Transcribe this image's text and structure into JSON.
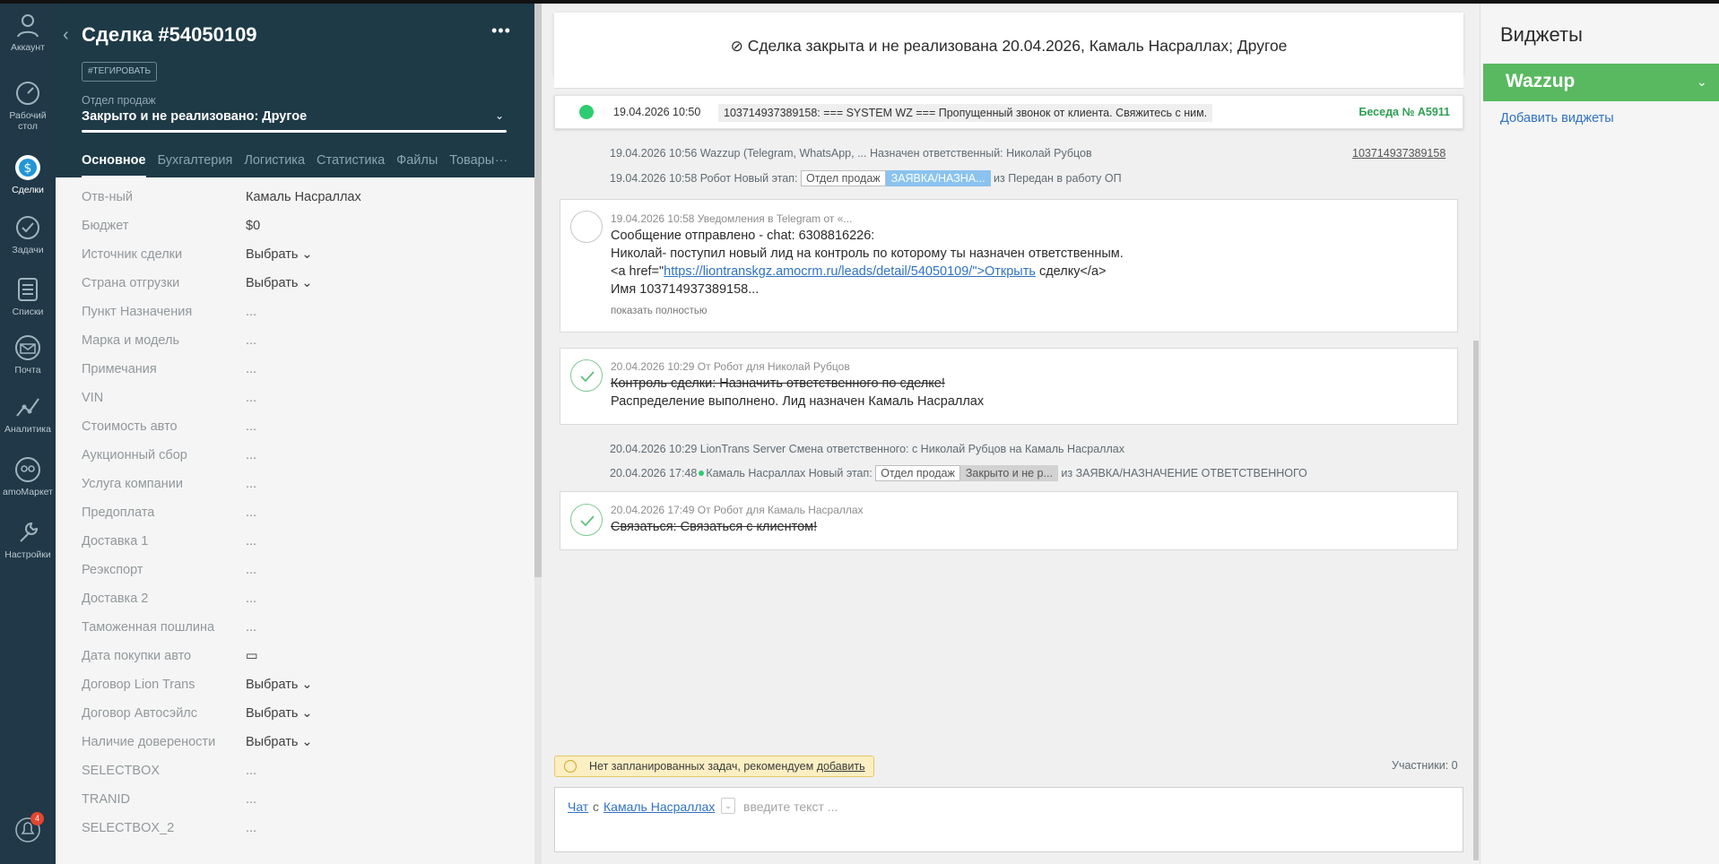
{
  "nav": {
    "items": [
      {
        "label": "Аккаунт",
        "icon": "user-icon"
      },
      {
        "label": "Рабочий стол",
        "icon": "dashboard-icon"
      },
      {
        "label": "Сделки",
        "icon": "deals-icon"
      },
      {
        "label": "Задачи",
        "icon": "tasks-icon"
      },
      {
        "label": "Списки",
        "icon": "lists-icon"
      },
      {
        "label": "Почта",
        "icon": "mail-icon"
      },
      {
        "label": "Аналитика",
        "icon": "analytics-icon"
      },
      {
        "label": "amoМаркет",
        "icon": "market-icon"
      },
      {
        "label": "Настройки",
        "icon": "settings-icon"
      }
    ],
    "notifications_badge": "4"
  },
  "card": {
    "title": "Сделка #54050109",
    "tag_button": "#ТЕГИРОВАТЬ",
    "pipeline": "Отдел продаж",
    "status": "Закрыто и не реализовано: Другое",
    "tabs": [
      "Основное",
      "Бухгалтерия",
      "Логистика",
      "Статистика",
      "Файлы",
      "Товары"
    ],
    "tabs_more": "···",
    "fields": [
      {
        "name": "Отв-ный",
        "value": "Камаль Насраллах"
      },
      {
        "name": "Бюджет",
        "value": "$0"
      },
      {
        "name": "Источник сделки",
        "value": "Выбрать ⌄"
      },
      {
        "name": "Страна отгрузки",
        "value": "Выбрать ⌄"
      },
      {
        "name": "Пункт Назначения",
        "value": "..."
      },
      {
        "name": "Марка и модель",
        "value": "..."
      },
      {
        "name": "Примечания",
        "value": "..."
      },
      {
        "name": "VIN",
        "value": "..."
      },
      {
        "name": "Стоимость авто",
        "value": "..."
      },
      {
        "name": "Аукционный сбор",
        "value": "..."
      },
      {
        "name": "Услуга компании",
        "value": "..."
      },
      {
        "name": "Предоплата",
        "value": "..."
      },
      {
        "name": "Доставка 1",
        "value": "..."
      },
      {
        "name": "Реэкспорт",
        "value": "..."
      },
      {
        "name": "Доставка 2",
        "value": "..."
      },
      {
        "name": "Таможенная пошлина",
        "value": "..."
      },
      {
        "name": "Дата покупки авто",
        "value": "▭"
      },
      {
        "name": "Договор Lion Trans",
        "value": "Выбрать ⌄"
      },
      {
        "name": "Договор Автосэйлс",
        "value": "Выбрать ⌄"
      },
      {
        "name": "Наличие доверености",
        "value": "Выбрать ⌄"
      },
      {
        "name": "SELECTBOX",
        "value": "..."
      },
      {
        "name": "TRANID",
        "value": "..."
      },
      {
        "name": "SELECTBOX_2",
        "value": "..."
      }
    ]
  },
  "feed": {
    "closed_banner": "Сделка закрыта и не реализована 20.04.2026, Камаль Насраллах; Другое",
    "whatsapp": {
      "time": "19.04.2026 10:50",
      "message": "103714937389158: === SYSTEM WZ === Пропущенный звонок от клиента. Свяжитесь с ним.",
      "conversation": "Беседа № A5911"
    },
    "notes": [
      {
        "text": "19.04.2026 10:56 Wazzup (Telegram, WhatsApp, ... Назначен ответственный: Николай Рубцов",
        "link": "103714937389158"
      },
      {
        "prefix": "19.04.2026 10:58 Робот Новый этап:",
        "pill1": "Отдел продаж",
        "pill2": "ЗАЯВКА/НАЗНА...",
        "suffix": "из Передан в работу ОП"
      },
      {
        "text": "20.04.2026 10:29 LionTrans Server Смена ответственного: с Николай Рубцов на Камаль Насраллах"
      },
      {
        "prefix": "20.04.2026 17:48",
        "author": "Камаль Насраллах Новый этап:",
        "pill1": "Отдел продаж",
        "pill2": "Закрыто и не р...",
        "suffix": "из ЗАЯВКА/НАЗНАЧЕНИЕ ОТВЕТСТВЕННОГО"
      }
    ],
    "telegram_card": {
      "meta": "19.04.2026 10:58 Уведомления в Telegram от «...",
      "line1": "Сообщение отправлено - chat: 6308816226:",
      "line2": "Николай- поступил новый лид на контроль по которому ты назначен ответственным.",
      "line3_pre": "<a href=\"",
      "line3_link": "https://liontranskgz.amocrm.ru/leads/detail/54050109/\">Открыть",
      "line3_post": "сделку</a>",
      "line4": "Имя 103714937389158...",
      "show_more": "показать полностью"
    },
    "task_card_1": {
      "meta": "20.04.2026 10:29  От Робот для Николай Рубцов",
      "line1": "Контроль сделки: Назначить ответственного по сделке!",
      "line2": "Распределение выполнено. Лид назначен Камаль Насраллах"
    },
    "task_card_2": {
      "meta": "20.04.2026 17:49  От Робот для Камаль Насраллах",
      "line1": "Связаться: Связаться с клиентом!"
    },
    "tasks_warning": "Нет запланированных задач, рекомендуем",
    "tasks_warning_link": "добавить",
    "participants": "Участники: 0",
    "chat": {
      "chat_link": "Чат",
      "with": "с",
      "recipient": "Камаль Насраллах",
      "colon": ":",
      "placeholder": "введите текст ..."
    }
  },
  "widgets": {
    "title": "Виджеты",
    "wazzup": "Wazzup",
    "add_link": "Добавить виджеты"
  },
  "colors": {
    "nav_bg": "#203847",
    "card_head_bg": "#1e3a47",
    "wazzup_green": "#59b960",
    "link_blue": "#2f72c4",
    "conversation_green": "#2e9e52"
  }
}
